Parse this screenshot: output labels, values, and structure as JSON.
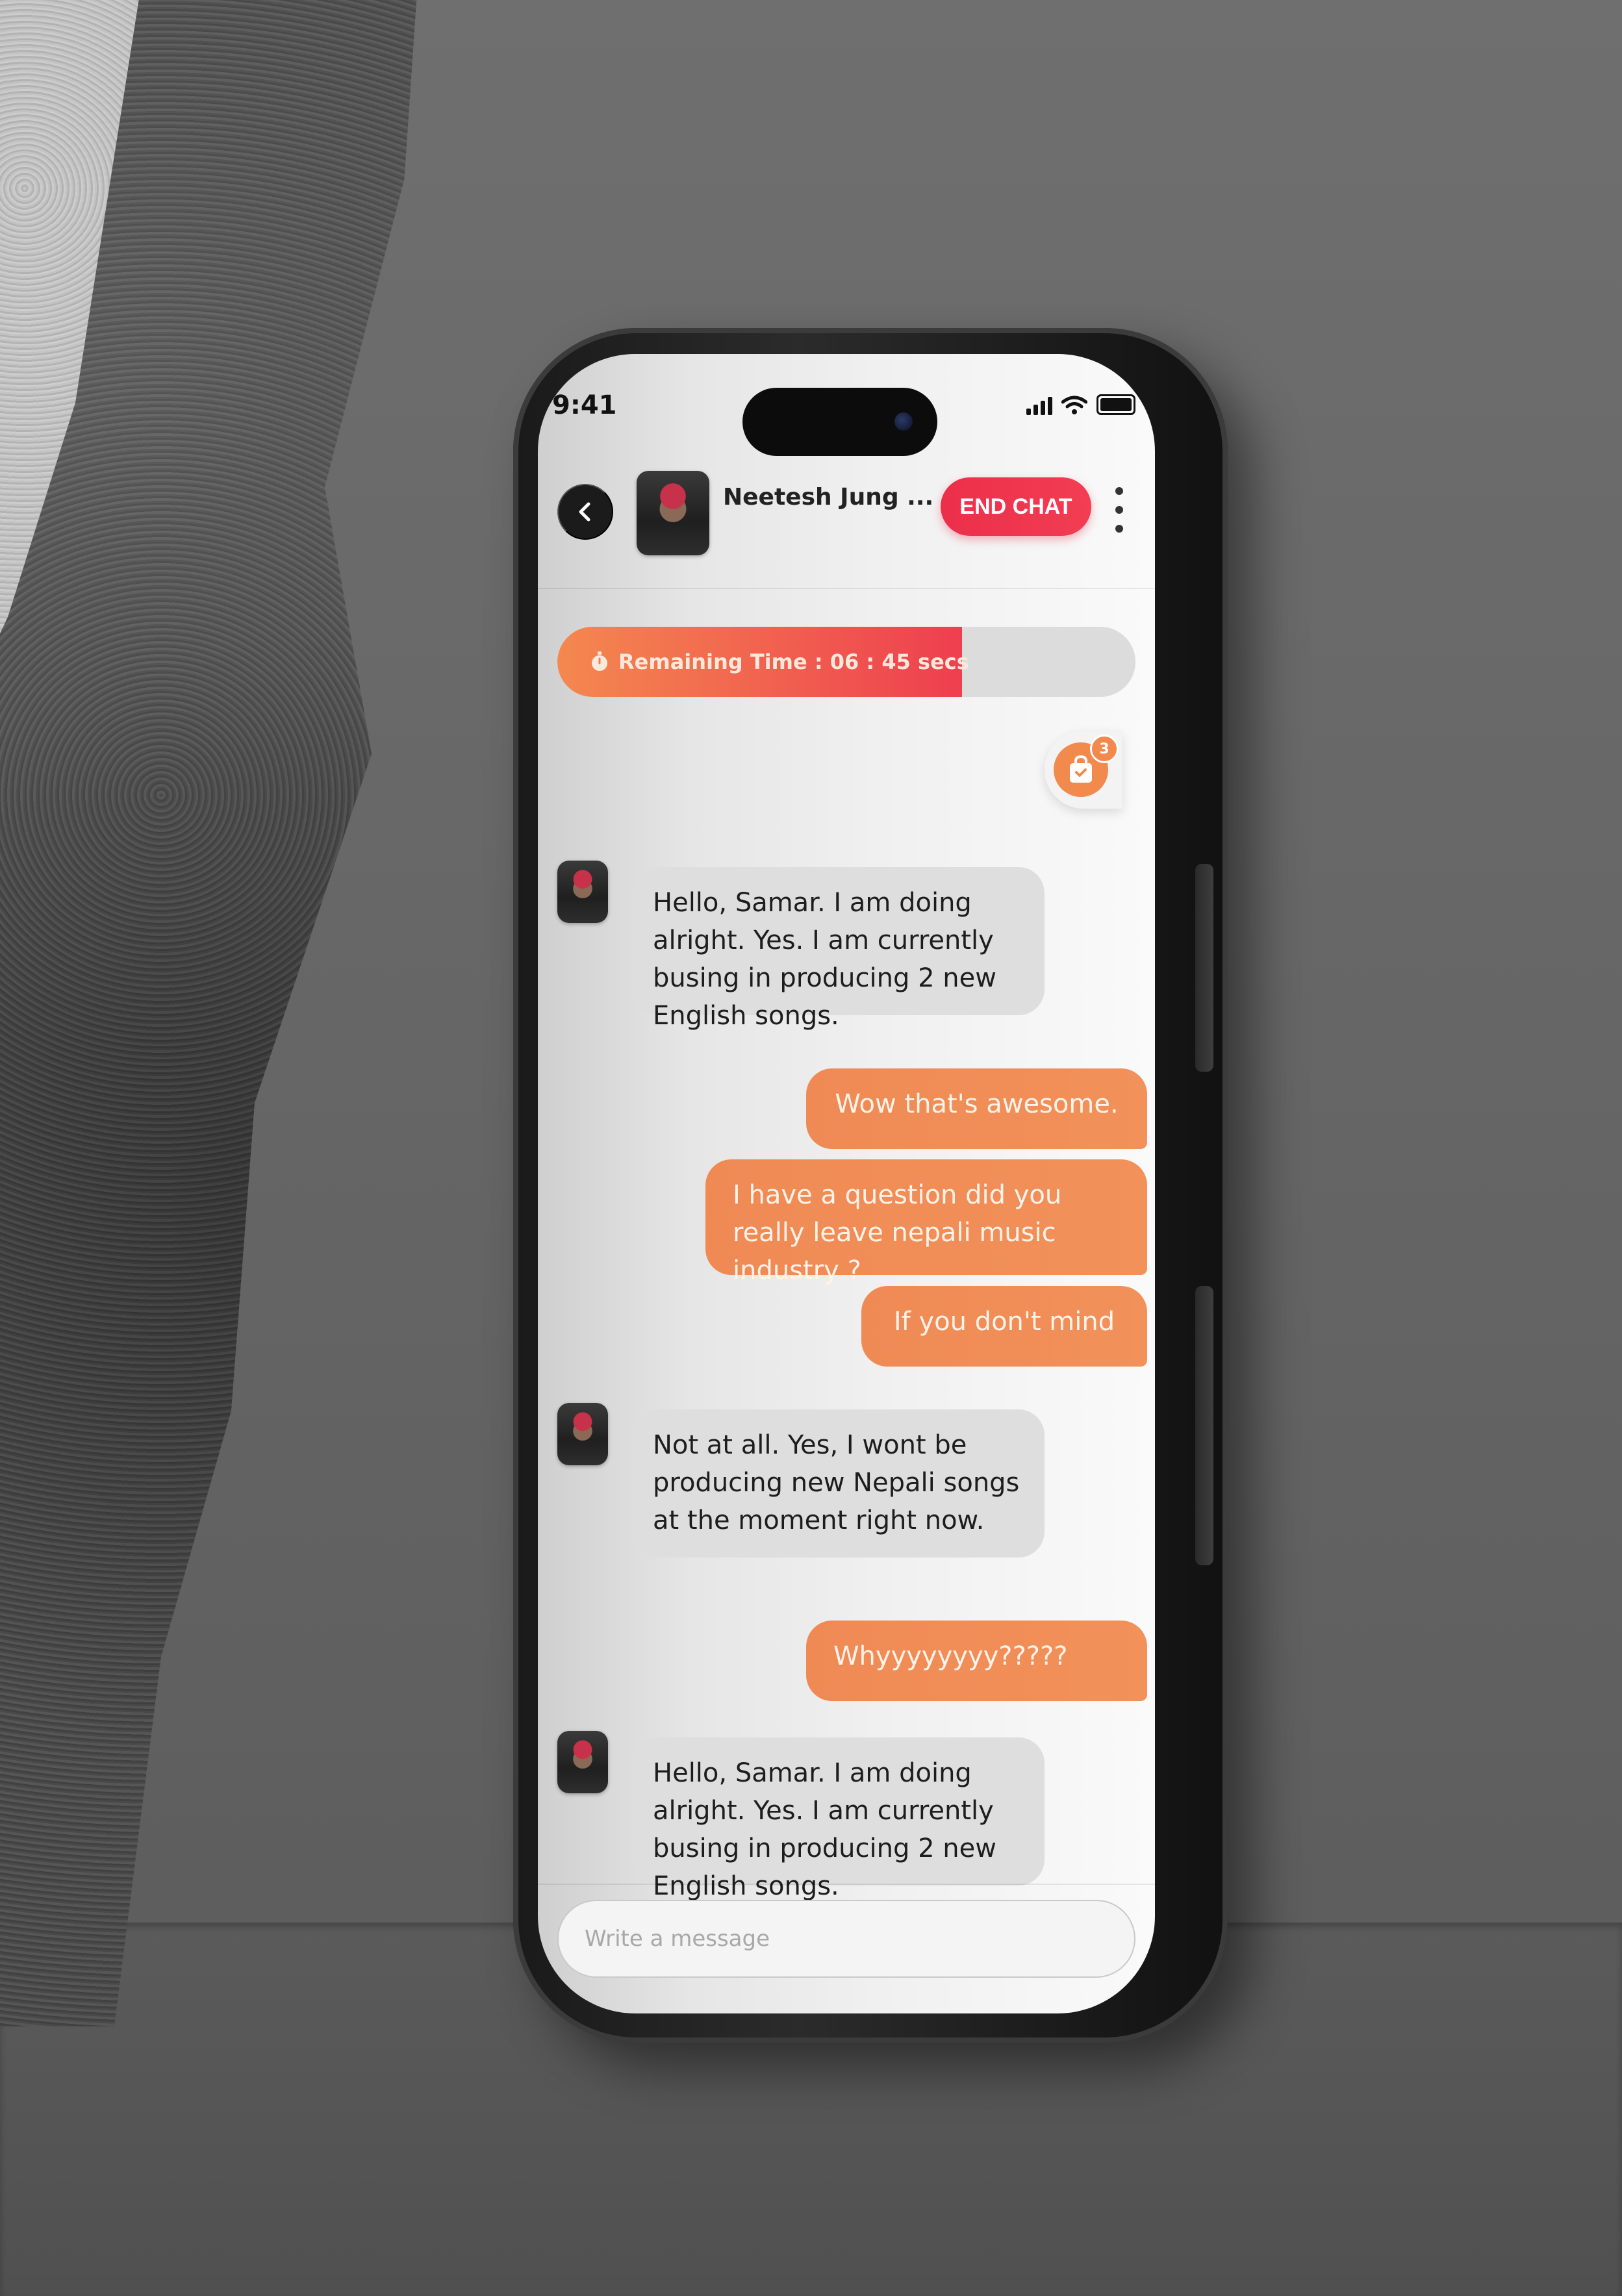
{
  "status_bar": {
    "time": "9:41"
  },
  "header": {
    "contact_name": "Neetesh Jung ...",
    "end_chat_label": "END CHAT"
  },
  "timer": {
    "label": "Remaining Time : 06 : 45 secs",
    "remaining_fraction": 0.7
  },
  "cart": {
    "badge_count": "3"
  },
  "messages": [
    {
      "from": "them",
      "text": "Hello, Samar. I am doing alright. Yes. I am currently busing in producing 2 new English songs."
    },
    {
      "from": "me",
      "text": "Wow that's awesome."
    },
    {
      "from": "me",
      "text": "I have a question did you really leave nepali music industry ?"
    },
    {
      "from": "me",
      "text": "If you don't mind"
    },
    {
      "from": "them",
      "text": "Not at all. Yes, I wont be producing new Nepali songs at the moment right now."
    },
    {
      "from": "me",
      "text": "Whyyyyyyyy?????"
    },
    {
      "from": "them",
      "text": "Hello, Samar. I am doing alright. Yes. I am currently busing in producing 2 new English songs."
    }
  ],
  "composer": {
    "placeholder": "Write a message"
  },
  "colors": {
    "accent_orange": "#F08A55",
    "end_chat_red": "#EC2F4B",
    "incoming_bubble": "#DEDEDE"
  }
}
